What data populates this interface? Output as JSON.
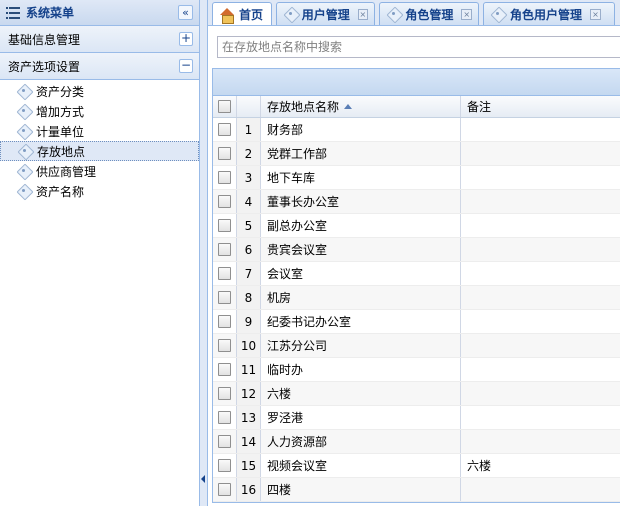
{
  "sidebar": {
    "title": "系统菜单",
    "collapse_icon": "«",
    "panels": [
      {
        "label": "基础信息管理",
        "toggle": "+"
      },
      {
        "label": "资产选项设置",
        "toggle": "−"
      }
    ],
    "items": [
      {
        "label": "资产分类"
      },
      {
        "label": "增加方式"
      },
      {
        "label": "计量单位"
      },
      {
        "label": "存放地点"
      },
      {
        "label": "供应商管理"
      },
      {
        "label": "资产名称"
      }
    ]
  },
  "tabs": [
    {
      "label": "首页",
      "icon": "home-icon"
    },
    {
      "label": "用户管理",
      "icon": "tag-icon",
      "close": "×"
    },
    {
      "label": "角色管理",
      "icon": "tag-icon",
      "close": "×"
    },
    {
      "label": "角色用户管理",
      "icon": "tag-icon",
      "close": "×"
    }
  ],
  "search": {
    "placeholder": "在存放地点名称中搜索",
    "value": ""
  },
  "grid": {
    "columns": {
      "name": "存放地点名称",
      "note": "备注"
    },
    "rows": [
      {
        "num": "1",
        "name": "财务部",
        "note": ""
      },
      {
        "num": "2",
        "name": "党群工作部",
        "note": ""
      },
      {
        "num": "3",
        "name": "地下车库",
        "note": ""
      },
      {
        "num": "4",
        "name": "董事长办公室",
        "note": ""
      },
      {
        "num": "5",
        "name": "副总办公室",
        "note": ""
      },
      {
        "num": "6",
        "name": "贵宾会议室",
        "note": ""
      },
      {
        "num": "7",
        "name": "会议室",
        "note": ""
      },
      {
        "num": "8",
        "name": "机房",
        "note": ""
      },
      {
        "num": "9",
        "name": "纪委书记办公室",
        "note": ""
      },
      {
        "num": "10",
        "name": "江苏分公司",
        "note": ""
      },
      {
        "num": "11",
        "name": "临时办",
        "note": ""
      },
      {
        "num": "12",
        "name": "六楼",
        "note": ""
      },
      {
        "num": "13",
        "name": "罗泾港",
        "note": ""
      },
      {
        "num": "14",
        "name": "人力资源部",
        "note": ""
      },
      {
        "num": "15",
        "name": "视频会议室",
        "note": "六楼"
      },
      {
        "num": "16",
        "name": "四楼",
        "note": ""
      }
    ]
  }
}
